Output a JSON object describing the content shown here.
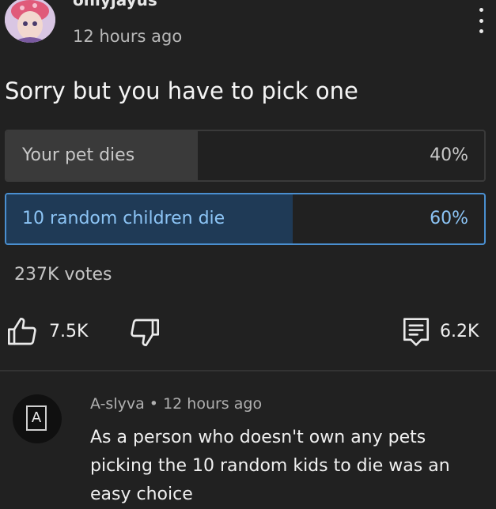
{
  "post": {
    "author": "onlyjayus",
    "time": "12 hours ago",
    "title": "Sorry but you have to pick one"
  },
  "poll": {
    "options": [
      {
        "label": "Your pet dies",
        "percent": "40%",
        "fraction": 0.4,
        "selected": false
      },
      {
        "label": "10 random children die",
        "percent": "60%",
        "fraction": 0.6,
        "selected": true
      }
    ],
    "votes": "237K votes"
  },
  "actions": {
    "likes": "7.5K",
    "comments": "6.2K"
  },
  "reply": {
    "author": "A-slyva",
    "separator": "•",
    "time": "12 hours ago",
    "avatar_letter": "A",
    "text": "As a person who doesn't own any pets picking the 10 random kids to die was an easy choice"
  },
  "colors": {
    "background": "#212121",
    "selected_border": "#4a8fd0",
    "selected_text": "#8cc4f5"
  }
}
